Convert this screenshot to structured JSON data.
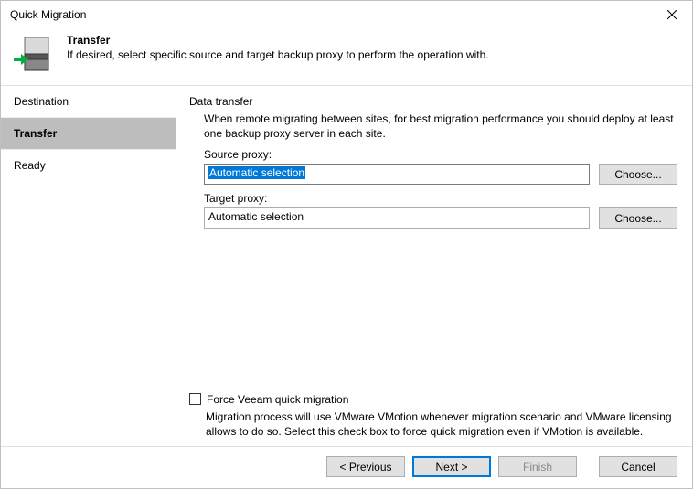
{
  "window": {
    "title": "Quick Migration"
  },
  "header": {
    "title": "Transfer",
    "description": "If desired, select specific source and target backup proxy to perform the operation with."
  },
  "sidebar": {
    "items": [
      {
        "label": "Destination",
        "active": false
      },
      {
        "label": "Transfer",
        "active": true
      },
      {
        "label": "Ready",
        "active": false
      }
    ]
  },
  "content": {
    "section_title": "Data transfer",
    "section_desc": "When remote migrating between sites, for best migration performance you should deploy at least one backup proxy server in each site.",
    "source": {
      "label": "Source proxy:",
      "value": "Automatic selection",
      "choose": "Choose..."
    },
    "target": {
      "label": "Target proxy:",
      "value": "Automatic selection",
      "choose": "Choose..."
    },
    "force": {
      "label": "Force Veeam quick migration",
      "note": "Migration process will use VMware VMotion whenever migration scenario and VMware licensing allows to do so. Select this check box to force quick migration even if VMotion is available."
    }
  },
  "footer": {
    "previous": "< Previous",
    "next": "Next >",
    "finish": "Finish",
    "cancel": "Cancel"
  }
}
